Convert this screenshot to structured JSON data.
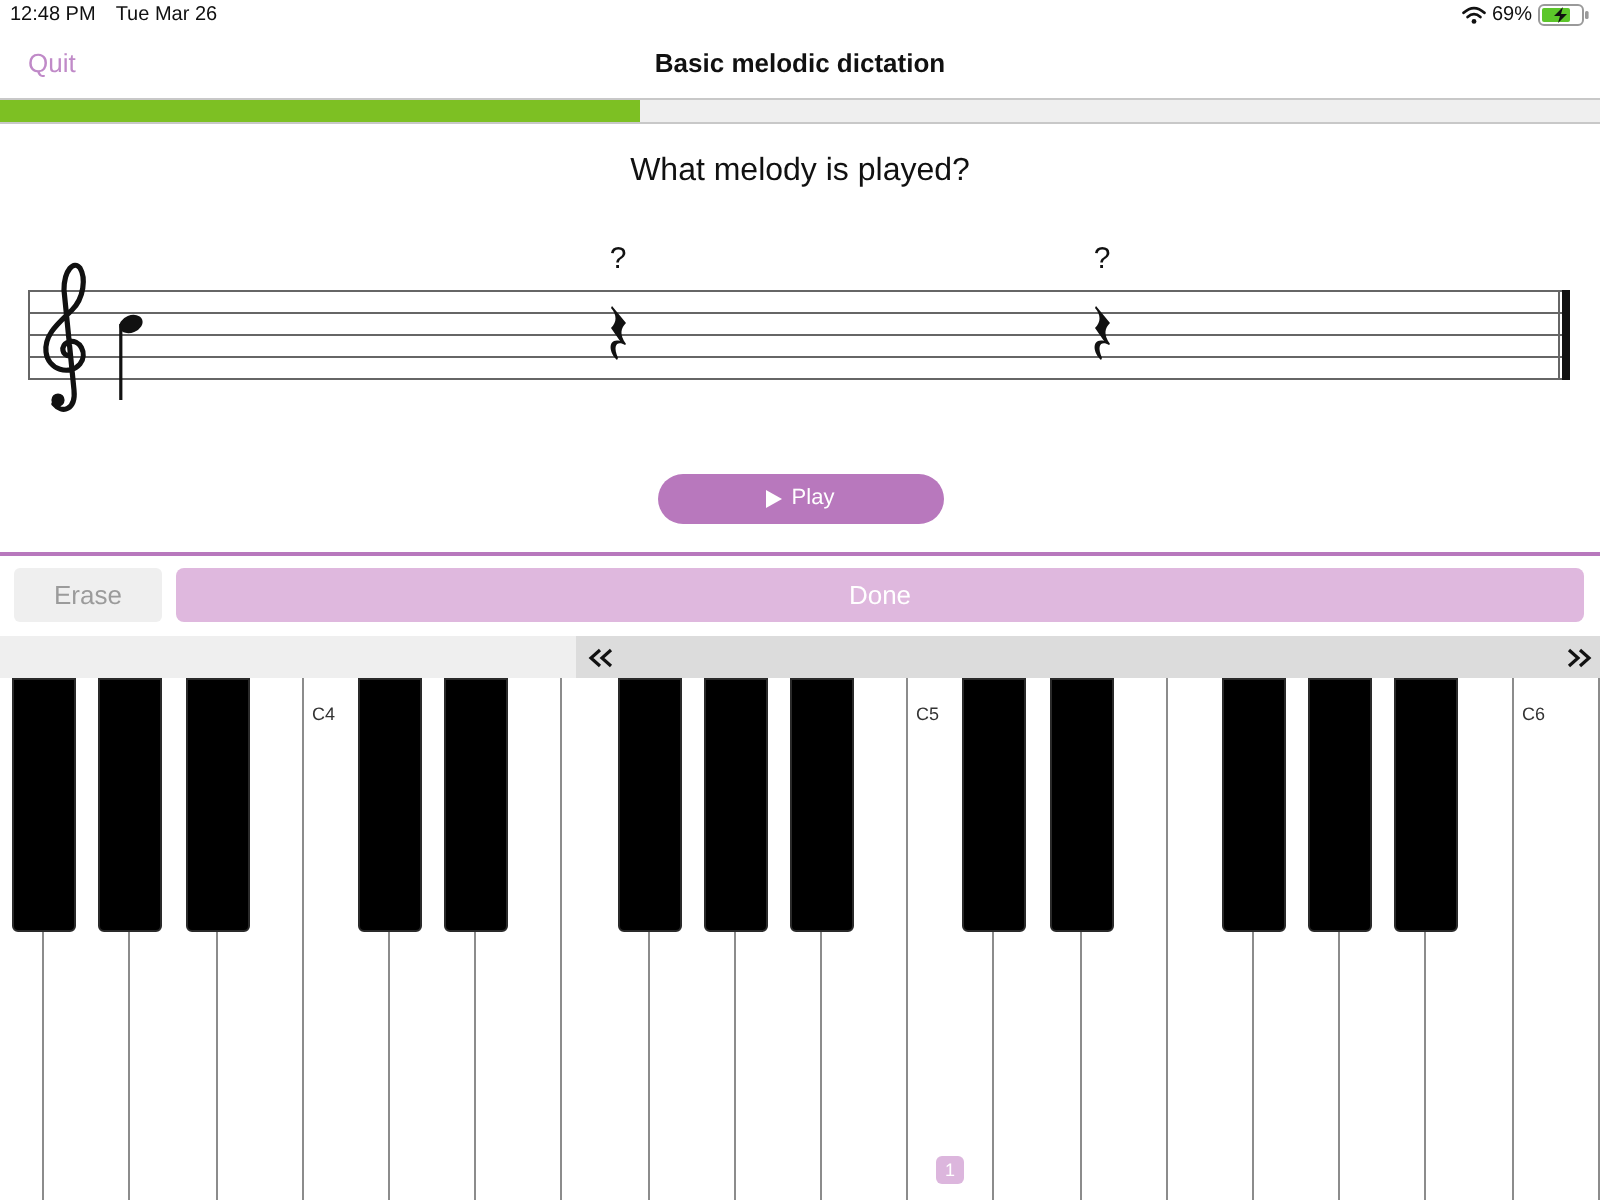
{
  "status_bar": {
    "time": "12:48 PM",
    "date": "Tue Mar 26",
    "battery": "69%"
  },
  "header": {
    "quit": "Quit",
    "title": "Basic melodic dictation"
  },
  "progress": {
    "level": 0.4
  },
  "question": "What melody is played?",
  "staff": {
    "items": [
      {
        "kind": "note"
      },
      {
        "kind": "rest",
        "mark": "?"
      },
      {
        "kind": "rest",
        "mark": "?"
      }
    ]
  },
  "play_button": {
    "label": "Play"
  },
  "actions": [
    {
      "kind": "secondary",
      "label": "Erase",
      "disabled": true
    },
    {
      "kind": "primary",
      "label": "Done",
      "disabled": true
    }
  ],
  "piano": {
    "keys": [
      {
        "kind": "natural"
      },
      {
        "kind": "sharp"
      },
      {
        "kind": "natural"
      },
      {
        "kind": "sharp"
      },
      {
        "kind": "natural"
      },
      {
        "kind": "sharp"
      },
      {
        "kind": "natural"
      },
      {
        "kind": "natural",
        "label": "C4"
      },
      {
        "kind": "sharp"
      },
      {
        "kind": "natural"
      },
      {
        "kind": "sharp"
      },
      {
        "kind": "natural"
      },
      {
        "kind": "natural"
      },
      {
        "kind": "sharp"
      },
      {
        "kind": "natural"
      },
      {
        "kind": "sharp"
      },
      {
        "kind": "natural"
      },
      {
        "kind": "sharp"
      },
      {
        "kind": "natural"
      },
      {
        "kind": "natural",
        "label": "C5",
        "badge": "1"
      },
      {
        "kind": "sharp"
      },
      {
        "kind": "natural"
      },
      {
        "kind": "sharp"
      },
      {
        "kind": "natural"
      },
      {
        "kind": "natural"
      },
      {
        "kind": "sharp"
      },
      {
        "kind": "natural"
      },
      {
        "kind": "sharp"
      },
      {
        "kind": "natural"
      },
      {
        "kind": "sharp"
      },
      {
        "kind": "natural"
      },
      {
        "kind": "natural",
        "label": "C6"
      }
    ]
  }
}
